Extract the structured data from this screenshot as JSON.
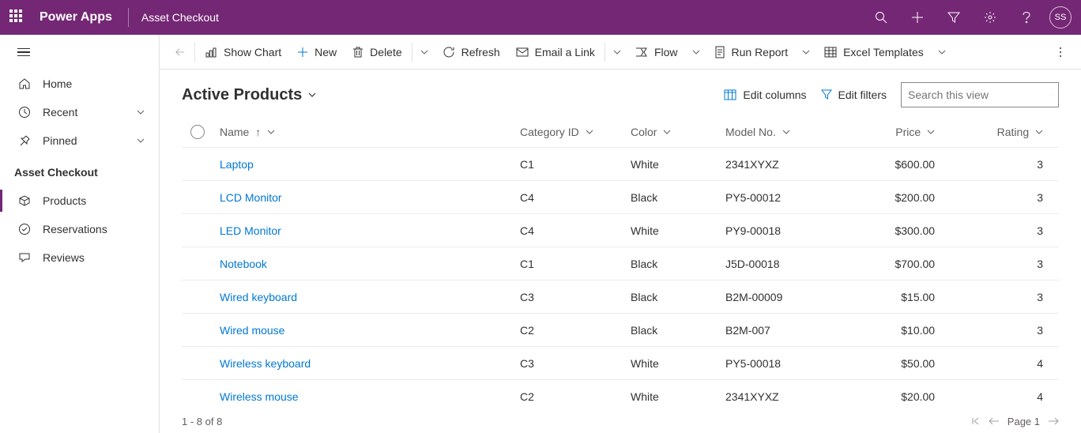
{
  "header": {
    "app_name": "Power Apps",
    "breadcrumb": "Asset Checkout",
    "avatar_initials": "SS"
  },
  "sidebar": {
    "home_label": "Home",
    "recent_label": "Recent",
    "pinned_label": "Pinned",
    "section_title": "Asset Checkout",
    "items": [
      {
        "label": "Products"
      },
      {
        "label": "Reservations"
      },
      {
        "label": "Reviews"
      }
    ]
  },
  "commands": {
    "show_chart": "Show Chart",
    "new": "New",
    "delete": "Delete",
    "refresh": "Refresh",
    "email_link": "Email a Link",
    "flow": "Flow",
    "run_report": "Run Report",
    "excel_templates": "Excel Templates"
  },
  "view": {
    "title": "Active Products",
    "edit_columns": "Edit columns",
    "edit_filters": "Edit filters",
    "search_placeholder": "Search this view"
  },
  "grid": {
    "columns": {
      "name": "Name",
      "category": "Category ID",
      "color": "Color",
      "model": "Model No.",
      "price": "Price",
      "rating": "Rating"
    },
    "rows": [
      {
        "name": "Laptop",
        "category": "C1",
        "color": "White",
        "model": "2341XYXZ",
        "price": "$600.00",
        "rating": "3"
      },
      {
        "name": "LCD Monitor",
        "category": "C4",
        "color": "Black",
        "model": "PY5-00012",
        "price": "$200.00",
        "rating": "3"
      },
      {
        "name": "LED Monitor",
        "category": "C4",
        "color": "White",
        "model": "PY9-00018",
        "price": "$300.00",
        "rating": "3"
      },
      {
        "name": "Notebook",
        "category": "C1",
        "color": "Black",
        "model": "J5D-00018",
        "price": "$700.00",
        "rating": "3"
      },
      {
        "name": "Wired keyboard",
        "category": "C3",
        "color": "Black",
        "model": "B2M-00009",
        "price": "$15.00",
        "rating": "3"
      },
      {
        "name": "Wired mouse",
        "category": "C2",
        "color": "Black",
        "model": "B2M-007",
        "price": "$10.00",
        "rating": "3"
      },
      {
        "name": "Wireless keyboard",
        "category": "C3",
        "color": "White",
        "model": "PY5-00018",
        "price": "$50.00",
        "rating": "4"
      },
      {
        "name": "Wireless mouse",
        "category": "C2",
        "color": "White",
        "model": "2341XYXZ",
        "price": "$20.00",
        "rating": "4"
      }
    ]
  },
  "footer": {
    "record_count": "1 - 8 of 8",
    "page_label": "Page 1"
  }
}
